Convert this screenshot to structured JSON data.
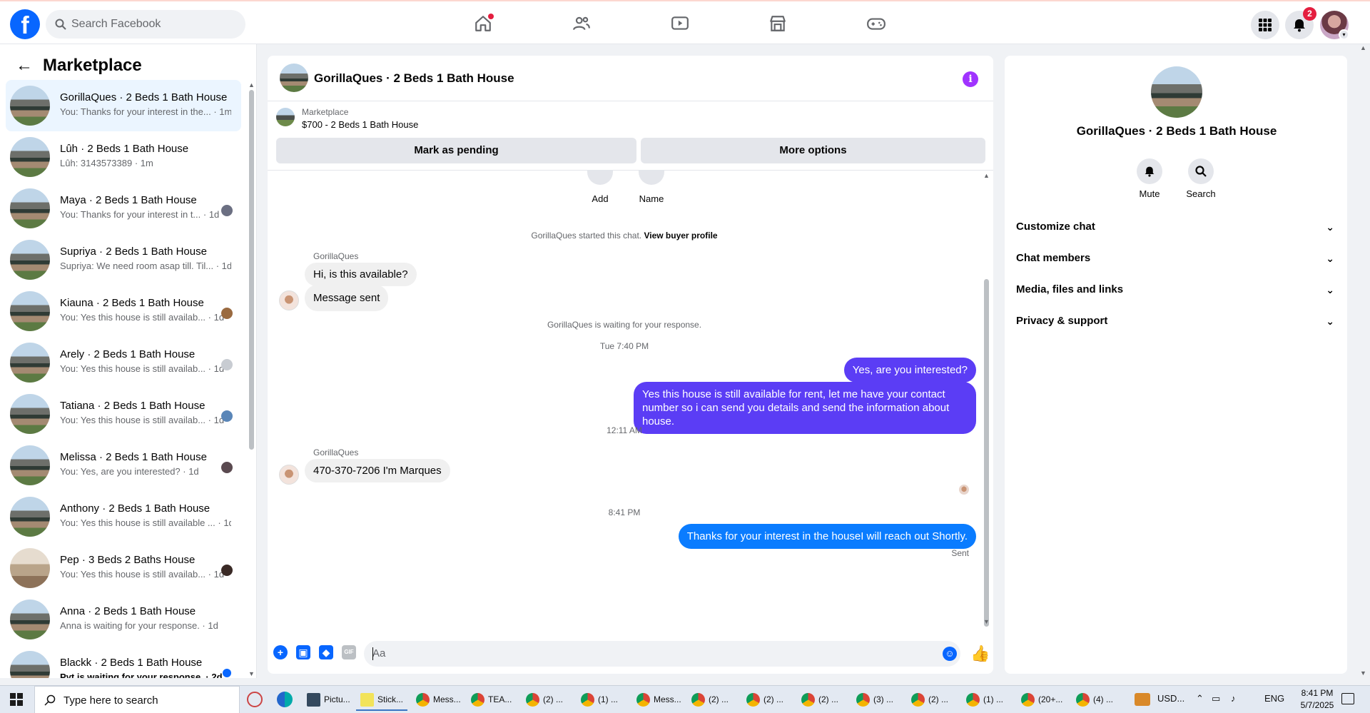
{
  "topbar": {
    "logo": "f",
    "search_placeholder": "Search Facebook",
    "notif_count": "2",
    "icons": [
      "home-icon",
      "friends-icon",
      "video-icon",
      "marketplace-icon",
      "gaming-icon",
      "menu-grid-icon",
      "bell-icon"
    ]
  },
  "sidebar": {
    "title": "Marketplace",
    "conversations": [
      {
        "title": "GorillaQues · 2 Beds 1 Bath House",
        "sub": "You: Thanks for your interest in the... · 1m"
      },
      {
        "title": "Lûh · 2 Beds 1 Bath House",
        "sub": "Lûh: 3143573389 · 1m"
      },
      {
        "title": "Maya · 2 Beds 1 Bath House",
        "sub": "You: Thanks for your interest in t... · 1d"
      },
      {
        "title": "Supriya · 2 Beds 1 Bath House",
        "sub": "Supriya: We need room asap till. Til... · 1d"
      },
      {
        "title": "Kiauna · 2 Beds 1 Bath House",
        "sub": "You: Yes this house is still availab... · 1d"
      },
      {
        "title": "Arely · 2 Beds 1 Bath House",
        "sub": "You: Yes this house is still availab... · 1d"
      },
      {
        "title": "Tatiana · 2 Beds 1 Bath House",
        "sub": "You: Yes this house is still availab... · 1d"
      },
      {
        "title": "Melissa · 2 Beds 1 Bath House",
        "sub": "You: Yes, are you interested? · 1d"
      },
      {
        "title": "Anthony · 2 Beds 1 Bath House",
        "sub": "You: Yes this house is still available ... · 1d"
      },
      {
        "title": "Pep · 3 Beds 2 Baths House",
        "sub": "You: Yes this house is still availab... · 1d"
      },
      {
        "title": "Anna · 2 Beds 1 Bath House",
        "sub": "Anna is waiting for your response. · 1d"
      },
      {
        "title": "Blackk · 2 Beds 1 Bath House",
        "sub": "Pyt is waiting for your response. · 2d"
      }
    ]
  },
  "chat": {
    "title": "GorillaQues · 2 Beds 1 Bath House",
    "listing_label": "Marketplace",
    "listing_price": "$700 - 2 Beds 1 Bath House",
    "mark_pending": "Mark as pending",
    "more_options": "More options",
    "add_label": "Add",
    "name_label": "Name",
    "started": "GorillaQues started this chat.",
    "view_profile": "View buyer profile",
    "sender": "GorillaQues",
    "msg_available": "Hi, is this available?",
    "msg_sent": "Message sent",
    "waiting": "GorillaQues is waiting for your response.",
    "time1": "Tue 7:40 PM",
    "out1": "Yes, are you interested?",
    "out2": "Yes this house is still available for rent, let me have your contact number so i can send you details and send the information about house.",
    "time2": "12:11 AM",
    "msg_phone": "470-370-7206 I'm Marques",
    "time3": "8:41 PM",
    "out3": "Thanks for your interest in the houseI will reach out Shortly.",
    "sent_status": "Sent",
    "composer_placeholder": "Aa"
  },
  "info": {
    "name": "GorillaQues · 2 Beds 1 Bath House",
    "mute": "Mute",
    "search": "Search",
    "sections": [
      "Customize chat",
      "Chat members",
      "Media, files and links",
      "Privacy & support"
    ]
  },
  "taskbar": {
    "search": "Type here to search",
    "apps": [
      "Pictu...",
      "Stick...",
      "Mess...",
      "TEA...",
      "(2) ...",
      "(1) ...",
      "Mess...",
      "(2) ...",
      "(2) ...",
      "(2) ...",
      "(3) ...",
      "(2) ...",
      "(1) ...",
      "(20+...",
      "(4) ..."
    ],
    "currency": "USD...",
    "lang": "ENG",
    "time": "8:41 PM",
    "date": "5/7/2025"
  },
  "colors": {
    "accent": "#0866ff",
    "outgoing_bubble": "#5b3df5",
    "latest_bubble": "#0a7cff",
    "badge": "#e41e3f"
  }
}
